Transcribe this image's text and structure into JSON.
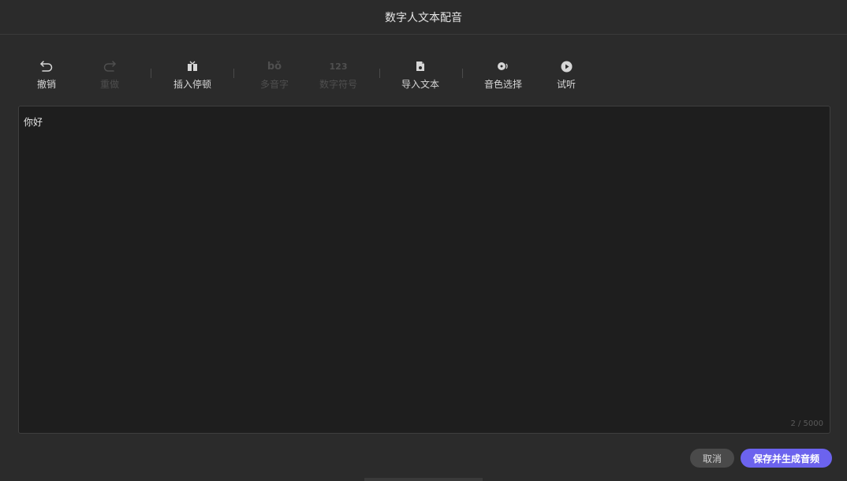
{
  "dialog": {
    "title": "数字人文本配音"
  },
  "toolbar": {
    "undo_label": "撤销",
    "redo_label": "重做",
    "insert_pause_label": "插入停顿",
    "polyphone_label": "多音字",
    "polyphone_icon_text": "bǒ",
    "number_symbol_label": "数字符号",
    "number_symbol_icon_text": "123",
    "import_text_label": "导入文本",
    "voice_select_label": "音色选择",
    "preview_label": "试听"
  },
  "editor": {
    "content": "你好",
    "counter": "2 / 5000"
  },
  "footer": {
    "cancel_label": "取消",
    "save_label": "保存并生成音频"
  },
  "colors": {
    "background": "#2b2b2b",
    "editor_background": "#1e1e1e",
    "accent": "#6c63ee"
  }
}
